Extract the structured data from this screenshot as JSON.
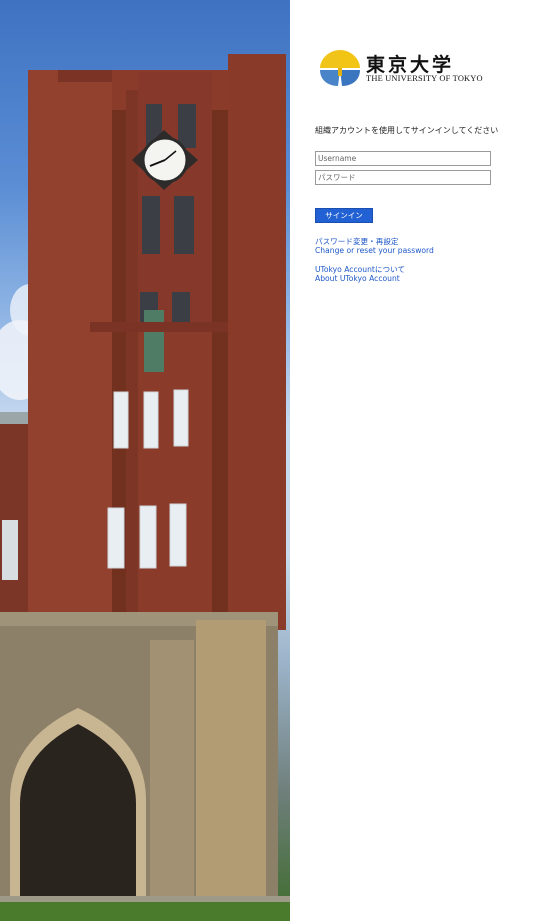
{
  "logo": {
    "name_ja": "東京大学",
    "name_en": "THE UNIVERSITY OF TOKYO"
  },
  "login": {
    "instruction": "組織アカウントを使用してサインインしてください",
    "username_placeholder": "Username",
    "password_placeholder": "パスワード",
    "signin_label": "サインイン"
  },
  "links": {
    "password_ja": "パスワード変更・再設定",
    "password_en": "Change or reset your password",
    "account_ja": "UTokyo Accountについて",
    "account_en": "About UTokyo Account"
  },
  "colors": {
    "accent": "#2161d3",
    "link": "#1d57c7",
    "brick": "#8b3b2a"
  }
}
